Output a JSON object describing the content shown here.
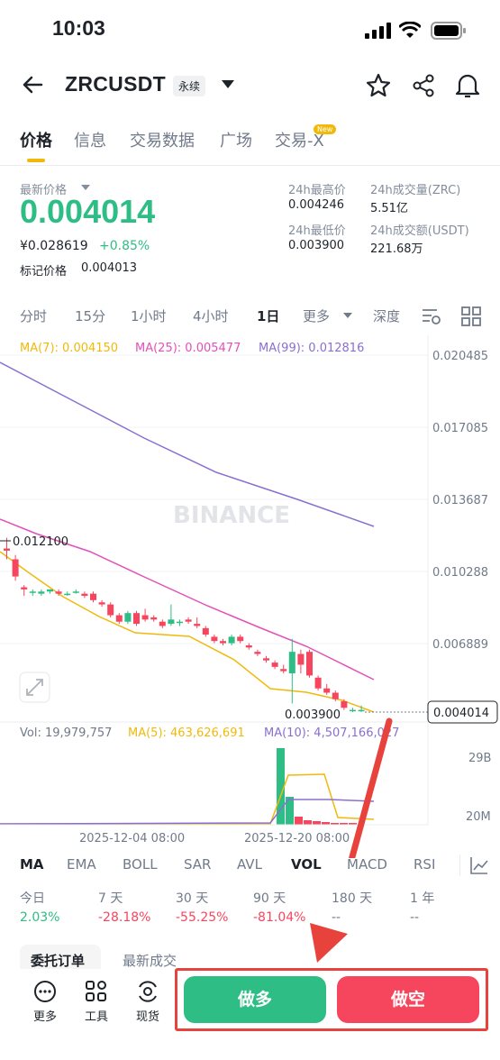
{
  "status": {
    "time": "10:03"
  },
  "header": {
    "pair": "ZRCUSDT",
    "contract_type": "永续"
  },
  "tabs": [
    {
      "label": "价格"
    },
    {
      "label": "信息"
    },
    {
      "label": "交易数据"
    },
    {
      "label": "广场"
    },
    {
      "label": "交易-X"
    }
  ],
  "new_badge": "New",
  "ticker": {
    "last_price_label": "最新价格",
    "last_price": "0.004014",
    "cny_price": "¥0.028619",
    "change": "+0.85%",
    "mark_price_label": "标记价格",
    "mark_price": "0.004013",
    "high_label": "24h最高价",
    "high": "0.004246",
    "vol_zrc_label": "24h成交量(ZRC)",
    "vol_zrc": "5.51亿",
    "low_label": "24h最低价",
    "low": "0.003900",
    "vol_usdt_label": "24h成交额(USDT)",
    "vol_usdt": "221.68万"
  },
  "intervals": [
    "分时",
    "15分",
    "1小时",
    "4小时",
    "1日",
    "更多",
    "深度"
  ],
  "ma_legend": {
    "ma7": "MA(7): 0.004150",
    "ma25": "MA(25): 0.005477",
    "ma99": "MA(99): 0.012816"
  },
  "watermark": "BINANCE",
  "chart_data": {
    "type": "candlestick",
    "y_ticks": [
      "0.020485",
      "0.017085",
      "0.013687",
      "0.010288",
      "0.006889"
    ],
    "current_price_label": "0.004014",
    "high_marker": "0.012100",
    "low_marker": "0.003900",
    "x_labels": [
      "2025-12-04 08:00",
      "2025-12-20 08:00"
    ],
    "candles": [
      [
        0.0115,
        0.012,
        0.011,
        0.0114
      ],
      [
        0.011,
        0.0112,
        0.01,
        0.0102
      ],
      [
        0.0097,
        0.0098,
        0.0093,
        0.0096
      ],
      [
        0.0095,
        0.0096,
        0.0093,
        0.0095
      ],
      [
        0.0094,
        0.0096,
        0.0093,
        0.0095
      ],
      [
        0.0095,
        0.0096,
        0.0094,
        0.0096
      ],
      [
        0.0095,
        0.0096,
        0.0093,
        0.0094
      ],
      [
        0.0094,
        0.0095,
        0.0093,
        0.0094
      ],
      [
        0.0095,
        0.0096,
        0.0094,
        0.0095
      ],
      [
        0.0094,
        0.0095,
        0.0092,
        0.0093
      ],
      [
        0.0094,
        0.0095,
        0.009,
        0.0091
      ],
      [
        0.009,
        0.0091,
        0.0088,
        0.0089
      ],
      [
        0.0089,
        0.009,
        0.0083,
        0.0084
      ],
      [
        0.0084,
        0.0085,
        0.008,
        0.0081
      ],
      [
        0.0081,
        0.0086,
        0.008,
        0.0085
      ],
      [
        0.0085,
        0.0086,
        0.0079,
        0.008
      ],
      [
        0.0084,
        0.0087,
        0.0081,
        0.0082
      ],
      [
        0.0083,
        0.0084,
        0.0081,
        0.0082
      ],
      [
        0.0081,
        0.0082,
        0.0078,
        0.0079
      ],
      [
        0.008,
        0.0089,
        0.0079,
        0.0082
      ],
      [
        0.0081,
        0.0082,
        0.0079,
        0.0081
      ],
      [
        0.0082,
        0.0083,
        0.008,
        0.0081
      ],
      [
        0.008,
        0.0083,
        0.0078,
        0.0079
      ],
      [
        0.0078,
        0.0079,
        0.0074,
        0.0075
      ],
      [
        0.0074,
        0.0075,
        0.0071,
        0.0072
      ],
      [
        0.0072,
        0.0073,
        0.007,
        0.0071
      ],
      [
        0.0071,
        0.0075,
        0.007,
        0.0074
      ],
      [
        0.0074,
        0.0075,
        0.0071,
        0.0072
      ],
      [
        0.007,
        0.0071,
        0.0068,
        0.0069
      ],
      [
        0.0067,
        0.0068,
        0.0065,
        0.0066
      ],
      [
        0.0064,
        0.0065,
        0.0062,
        0.0063
      ],
      [
        0.0062,
        0.0063,
        0.0059,
        0.006
      ],
      [
        0.0059,
        0.0061,
        0.0057,
        0.0058
      ],
      [
        0.0057,
        0.0073,
        0.0043,
        0.0067
      ],
      [
        0.0066,
        0.0068,
        0.0057,
        0.0061
      ],
      [
        0.0067,
        0.0068,
        0.0055,
        0.0056
      ],
      [
        0.0055,
        0.0056,
        0.0049,
        0.005
      ],
      [
        0.005,
        0.0052,
        0.0047,
        0.0048
      ],
      [
        0.0048,
        0.0049,
        0.0044,
        0.0045
      ],
      [
        0.0044,
        0.0045,
        0.004,
        0.0041
      ],
      [
        0.004,
        0.0041,
        0.0039,
        0.004
      ],
      [
        0.004,
        0.0042,
        0.0039,
        0.004
      ]
    ],
    "volume_legend": {
      "vol": "Vol: 19,979,757",
      "ma5": "MA(5): 463,626,691",
      "ma10": "MA(10): 4,507,166,027"
    },
    "vol_ticks": [
      "29B",
      "20M"
    ]
  },
  "indicators": [
    "MA",
    "EMA",
    "BOLL",
    "SAR",
    "AVL",
    "VOL",
    "MACD",
    "RSI"
  ],
  "performance": [
    {
      "label": "今日",
      "value": "2.03%",
      "color": "#2ebd85"
    },
    {
      "label": "7 天",
      "value": "-28.18%",
      "color": "#f6465d"
    },
    {
      "label": "30 天",
      "value": "-55.25%",
      "color": "#f6465d"
    },
    {
      "label": "90 天",
      "value": "-81.04%",
      "color": "#f6465d"
    },
    {
      "label": "180 天",
      "value": "--",
      "color": "#707a8a"
    },
    {
      "label": "1 年",
      "value": "--",
      "color": "#707a8a"
    }
  ],
  "lower_tabs": [
    "委托订单",
    "最新成交"
  ],
  "bottom": {
    "more": "更多",
    "tools": "工具",
    "spot": "现货",
    "long": "做多",
    "short": "做空"
  },
  "colors": {
    "up": "#2ebd85",
    "down": "#f6465d",
    "accent": "#f0b90b",
    "annotation": "#e8423c"
  }
}
